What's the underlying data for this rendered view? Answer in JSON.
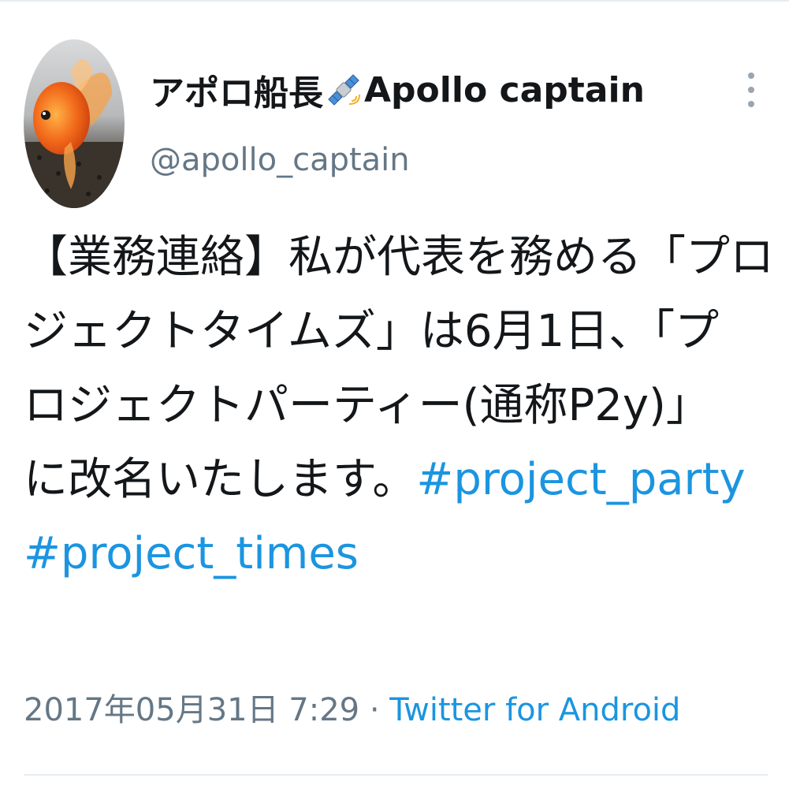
{
  "tweet": {
    "author": {
      "display_name_prefix": "アポロ船長",
      "display_name_icon": "satellite-icon",
      "display_name_suffix": "Apollo captain",
      "handle": "@apollo_captain",
      "avatar_icon": "goldfish-avatar"
    },
    "text": {
      "line1": "【業務連絡】私が代表を務める「プロ",
      "line2": "ジェクトタイムズ」は6月1日、「プ",
      "line3": "ロジェクトパーティー(通称P2y)」",
      "line4_text": "に改名いたします。",
      "hashtag1": "#project_party",
      "hashtag2": "#project_times"
    },
    "timestamp": "2017年05月31日 7:29",
    "separator": "·",
    "source": "Twitter for Android",
    "more_icon": "more-vertical-icon"
  },
  "colors": {
    "text": "#14171a",
    "secondary": "#657786",
    "link": "#1b95e0",
    "divider": "#e6ecf0"
  }
}
